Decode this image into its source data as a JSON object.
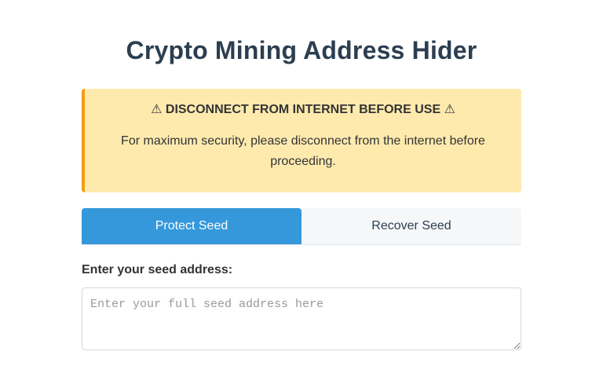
{
  "page": {
    "title": "Crypto Mining Address Hider"
  },
  "warning": {
    "heading": "⚠ DISCONNECT FROM INTERNET BEFORE USE ⚠",
    "text": "For maximum security, please disconnect from the internet before proceeding."
  },
  "tabs": [
    {
      "label": "Protect Seed",
      "active": true
    },
    {
      "label": "Recover Seed",
      "active": false
    }
  ],
  "seed_field": {
    "label": "Enter your seed address:",
    "value": "",
    "placeholder": "Enter your full seed address here"
  },
  "colors": {
    "title": "#2c3e50",
    "warning_bg": "#ffeaae",
    "warning_border": "#f39c12",
    "active_tab": "#3498db",
    "inactive_tab": "#f5f7f9"
  }
}
